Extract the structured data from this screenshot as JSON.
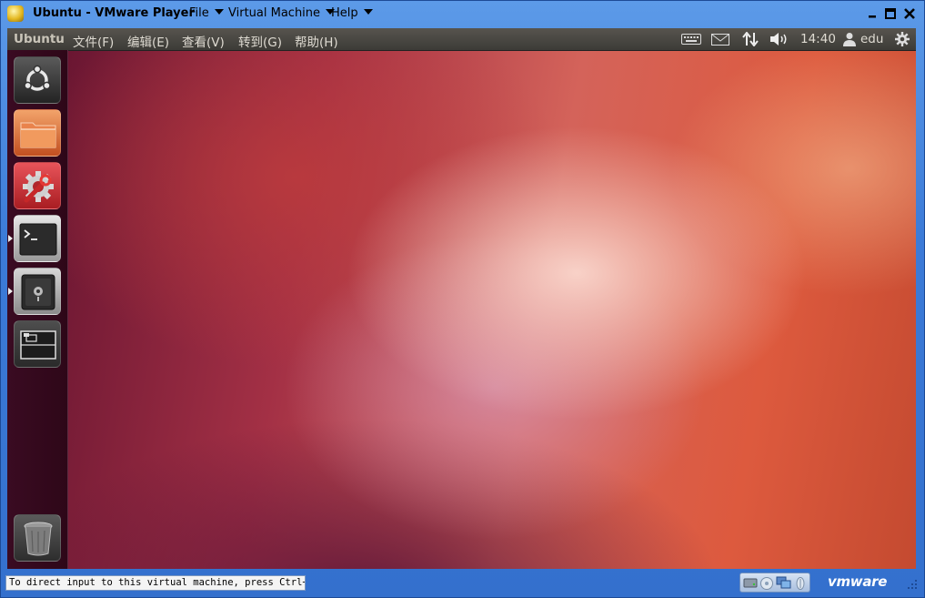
{
  "window": {
    "title": "Ubuntu - VMware Player",
    "menus": [
      {
        "label": "File"
      },
      {
        "label": "Virtual Machine"
      },
      {
        "label": "Help"
      }
    ]
  },
  "topbar": {
    "brand": "Ubuntu",
    "menus": [
      {
        "label": "文件(F)"
      },
      {
        "label": "编辑(E)"
      },
      {
        "label": "查看(V)"
      },
      {
        "label": "转到(G)"
      },
      {
        "label": "帮助(H)"
      }
    ],
    "clock": "14:40",
    "user": "edu"
  },
  "launcher": {
    "items": [
      {
        "name": "dash-home",
        "icon": "ubuntu-logo-icon"
      },
      {
        "name": "home-folder",
        "icon": "folder-icon"
      },
      {
        "name": "system-settings",
        "icon": "settings-gear-wrench-icon"
      },
      {
        "name": "terminal",
        "icon": "terminal-icon"
      },
      {
        "name": "app-safe",
        "icon": "safe-icon"
      },
      {
        "name": "workspace-switcher",
        "icon": "workspace-switcher-icon"
      },
      {
        "name": "trash",
        "icon": "trash-icon"
      }
    ]
  },
  "statusbar": {
    "message": "To direct input to this virtual machine, press Ctrl+G.",
    "brand": "vmware"
  }
}
